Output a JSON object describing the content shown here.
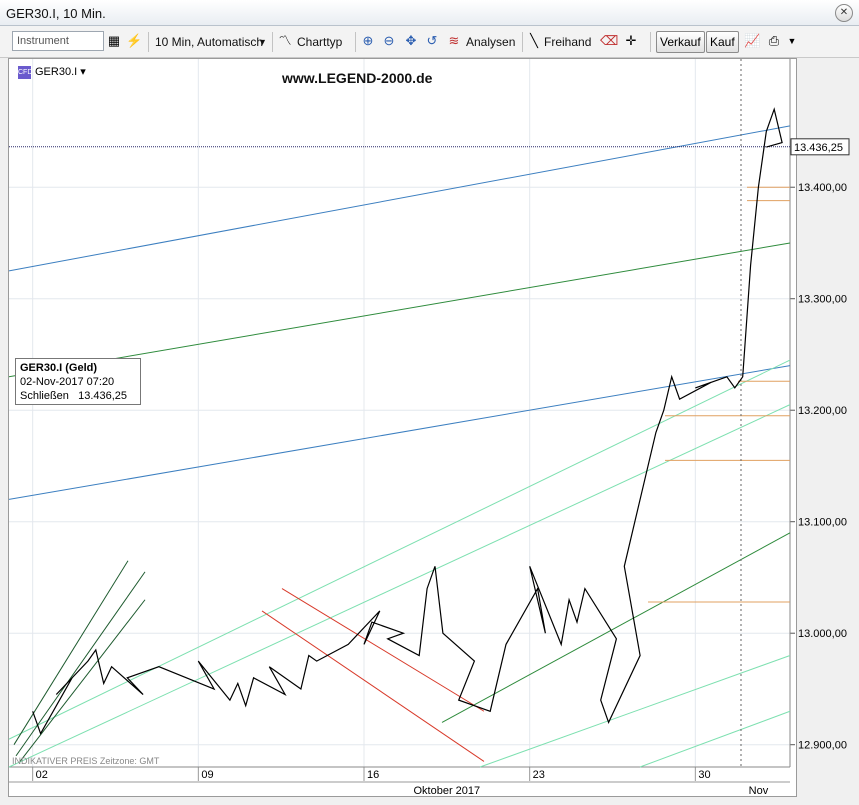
{
  "window": {
    "title": "GER30.I, 10 Min.",
    "close_symbol": "✕"
  },
  "toolbar": {
    "instrument_placeholder": "Instrument",
    "timeframe": "10 Min,  Automatisch",
    "charttype": "Charttyp",
    "analysen": "Analysen",
    "freihand": "Freihand",
    "verkauf": "Verkauf",
    "kauf": "Kauf"
  },
  "chart_header": {
    "instrument": "GER30.I",
    "watermark": "www.LEGEND-2000.de"
  },
  "infobox": {
    "title": "GER30.I (Geld)",
    "datetime": "02-Nov-2017 07:20",
    "close_label": "Schließen",
    "close_value": "13.436,25"
  },
  "footnote": "INDIKATIVER PREIS   Zeitzone: GMT",
  "colors": {
    "price": "#000000",
    "blue_channel": "#3c7fc0",
    "green_line": "#2e8b3c",
    "light_green": "#7de0b0",
    "dark_green": "#1d5a2e",
    "red_channel": "#d83a2a",
    "orange": "#e0a060",
    "current_price_line": "#2a2a6a"
  },
  "chart_data": {
    "type": "line",
    "title": "GER30.I, 10 Min.",
    "y_ticks": [
      "12.900,00",
      "13.000,00",
      "13.100,00",
      "13.200,00",
      "13.300,00",
      "13.400,00"
    ],
    "ylim": [
      12880,
      13515
    ],
    "x_ticks": [
      "02",
      "09",
      "16",
      "23",
      "30"
    ],
    "month_labels": [
      "Oktober 2017",
      "Nov"
    ],
    "current_price": 13436.25,
    "current_price_label": "13.436,25",
    "x_range": [
      "2017-10-02",
      "2017-11-02"
    ],
    "series": [
      {
        "x": [
          "2017-10-02",
          "2017-10-02",
          "2017-10-03",
          "2017-10-03",
          "2017-10-04",
          "2017-10-04",
          "2017-10-05",
          "2017-10-05",
          "2017-10-06",
          "2017-10-06",
          "2017-10-07",
          "2017-10-09",
          "2017-10-09",
          "2017-10-10",
          "2017-10-10",
          "2017-10-11",
          "2017-10-11",
          "2017-10-12",
          "2017-10-12",
          "2017-10-13",
          "2017-10-13",
          "2017-10-14",
          "2017-10-15",
          "2017-10-16",
          "2017-10-16",
          "2017-10-16",
          "2017-10-17",
          "2017-10-17",
          "2017-10-18",
          "2017-10-18",
          "2017-10-19",
          "2017-10-19",
          "2017-10-20",
          "2017-10-20",
          "2017-10-21",
          "2017-10-21",
          "2017-10-22",
          "2017-10-23",
          "2017-10-23",
          "2017-10-23",
          "2017-10-24",
          "2017-10-24",
          "2017-10-25",
          "2017-10-25",
          "2017-10-26",
          "2017-10-26",
          "2017-10-26",
          "2017-10-27",
          "2017-10-27",
          "2017-10-28",
          "2017-10-28",
          "2017-10-29",
          "2017-10-29",
          "2017-10-30",
          "2017-10-30",
          "2017-10-31",
          "2017-10-31",
          "2017-11-01",
          "2017-11-01",
          "2017-11-01",
          "2017-11-02",
          "2017-11-02",
          "2017-11-02",
          "2017-11-02"
        ],
        "values": [
          12930,
          12910,
          12960,
          12945,
          12975,
          12985,
          12955,
          12970,
          12945,
          12960,
          12970,
          12950,
          12975,
          12940,
          12955,
          12935,
          12960,
          12945,
          12970,
          12950,
          12980,
          12975,
          12990,
          13020,
          12990,
          13010,
          13000,
          12995,
          12980,
          13040,
          13060,
          13000,
          12975,
          12940,
          12930,
          12960,
          12990,
          13040,
          13000,
          13060,
          12990,
          13030,
          13010,
          13040,
          12995,
          12940,
          12920,
          12980,
          13060,
          13180,
          13200,
          13230,
          13210,
          13225,
          13220,
          13230,
          13220,
          13230,
          13330,
          13400,
          13450,
          13470,
          13440,
          13436
        ]
      }
    ]
  }
}
